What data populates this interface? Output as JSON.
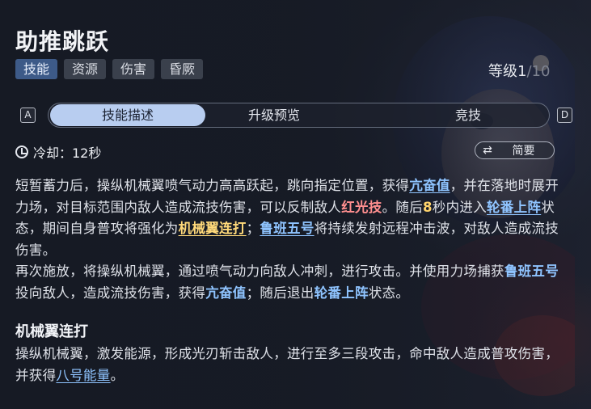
{
  "skill": {
    "title": "助推跳跃",
    "tags": [
      "技能",
      "资源",
      "伤害",
      "昏厥"
    ],
    "level_label": "等级",
    "level_current": "1",
    "level_max": "/10"
  },
  "tabs": {
    "left_key": "A",
    "right_key": "D",
    "items": [
      "技能描述",
      "升级预览",
      "竞技"
    ]
  },
  "cooldown": {
    "label": "冷却：12秒"
  },
  "brief_button": {
    "icon": "⇄",
    "label": "简要"
  },
  "description": {
    "p1_a": "短暂蓄力后，操纵机械翼喷气动力高高跃起，跳向指定位置，获得",
    "p1_kw1": "亢奋值",
    "p1_b": "，并在落地时展开力场，对目标范围内敌人造成流技伤害，可以反制敌人",
    "p1_red": "红光技",
    "p1_c": "。随后",
    "p1_num": "8",
    "p1_d": "秒内进入",
    "p1_kw2": "轮番上阵",
    "p1_e": "状态，期间自身普攻将强化为",
    "p1_gold": "机械翼连打",
    "p1_f": "；",
    "p1_kw3": "鲁班五号",
    "p1_g": "将持续发射远程冲击波，对敌人造成流技伤害。",
    "p2_a": "再次施放，将操纵机械翼，通过喷气动力向敌人冲刺，进行攻击。并使用力场捕获",
    "p2_blue": "鲁班五号",
    "p2_b": "投向敌人，造成流技伤害，获得",
    "p2_kw1": "亢奋值",
    "p2_c": "；随后退出",
    "p2_kw2": "轮番上阵",
    "p2_d": "状态。"
  },
  "sub_skill": {
    "title": "机械翼连打",
    "desc_a": "操纵机械翼，激发能源，形成光刃斩击敌人，进行至多三段攻击，命中敌人造成普攻伤害，并获得",
    "desc_kw": "八号能量",
    "desc_b": "。"
  },
  "colors": {
    "keyword_blue": "#8fc4ff",
    "keyword_red": "#ff8f8f",
    "keyword_gold": "#ffd97a",
    "active_tab": "#b8cdf0",
    "active_tag": "#3d5a88"
  }
}
